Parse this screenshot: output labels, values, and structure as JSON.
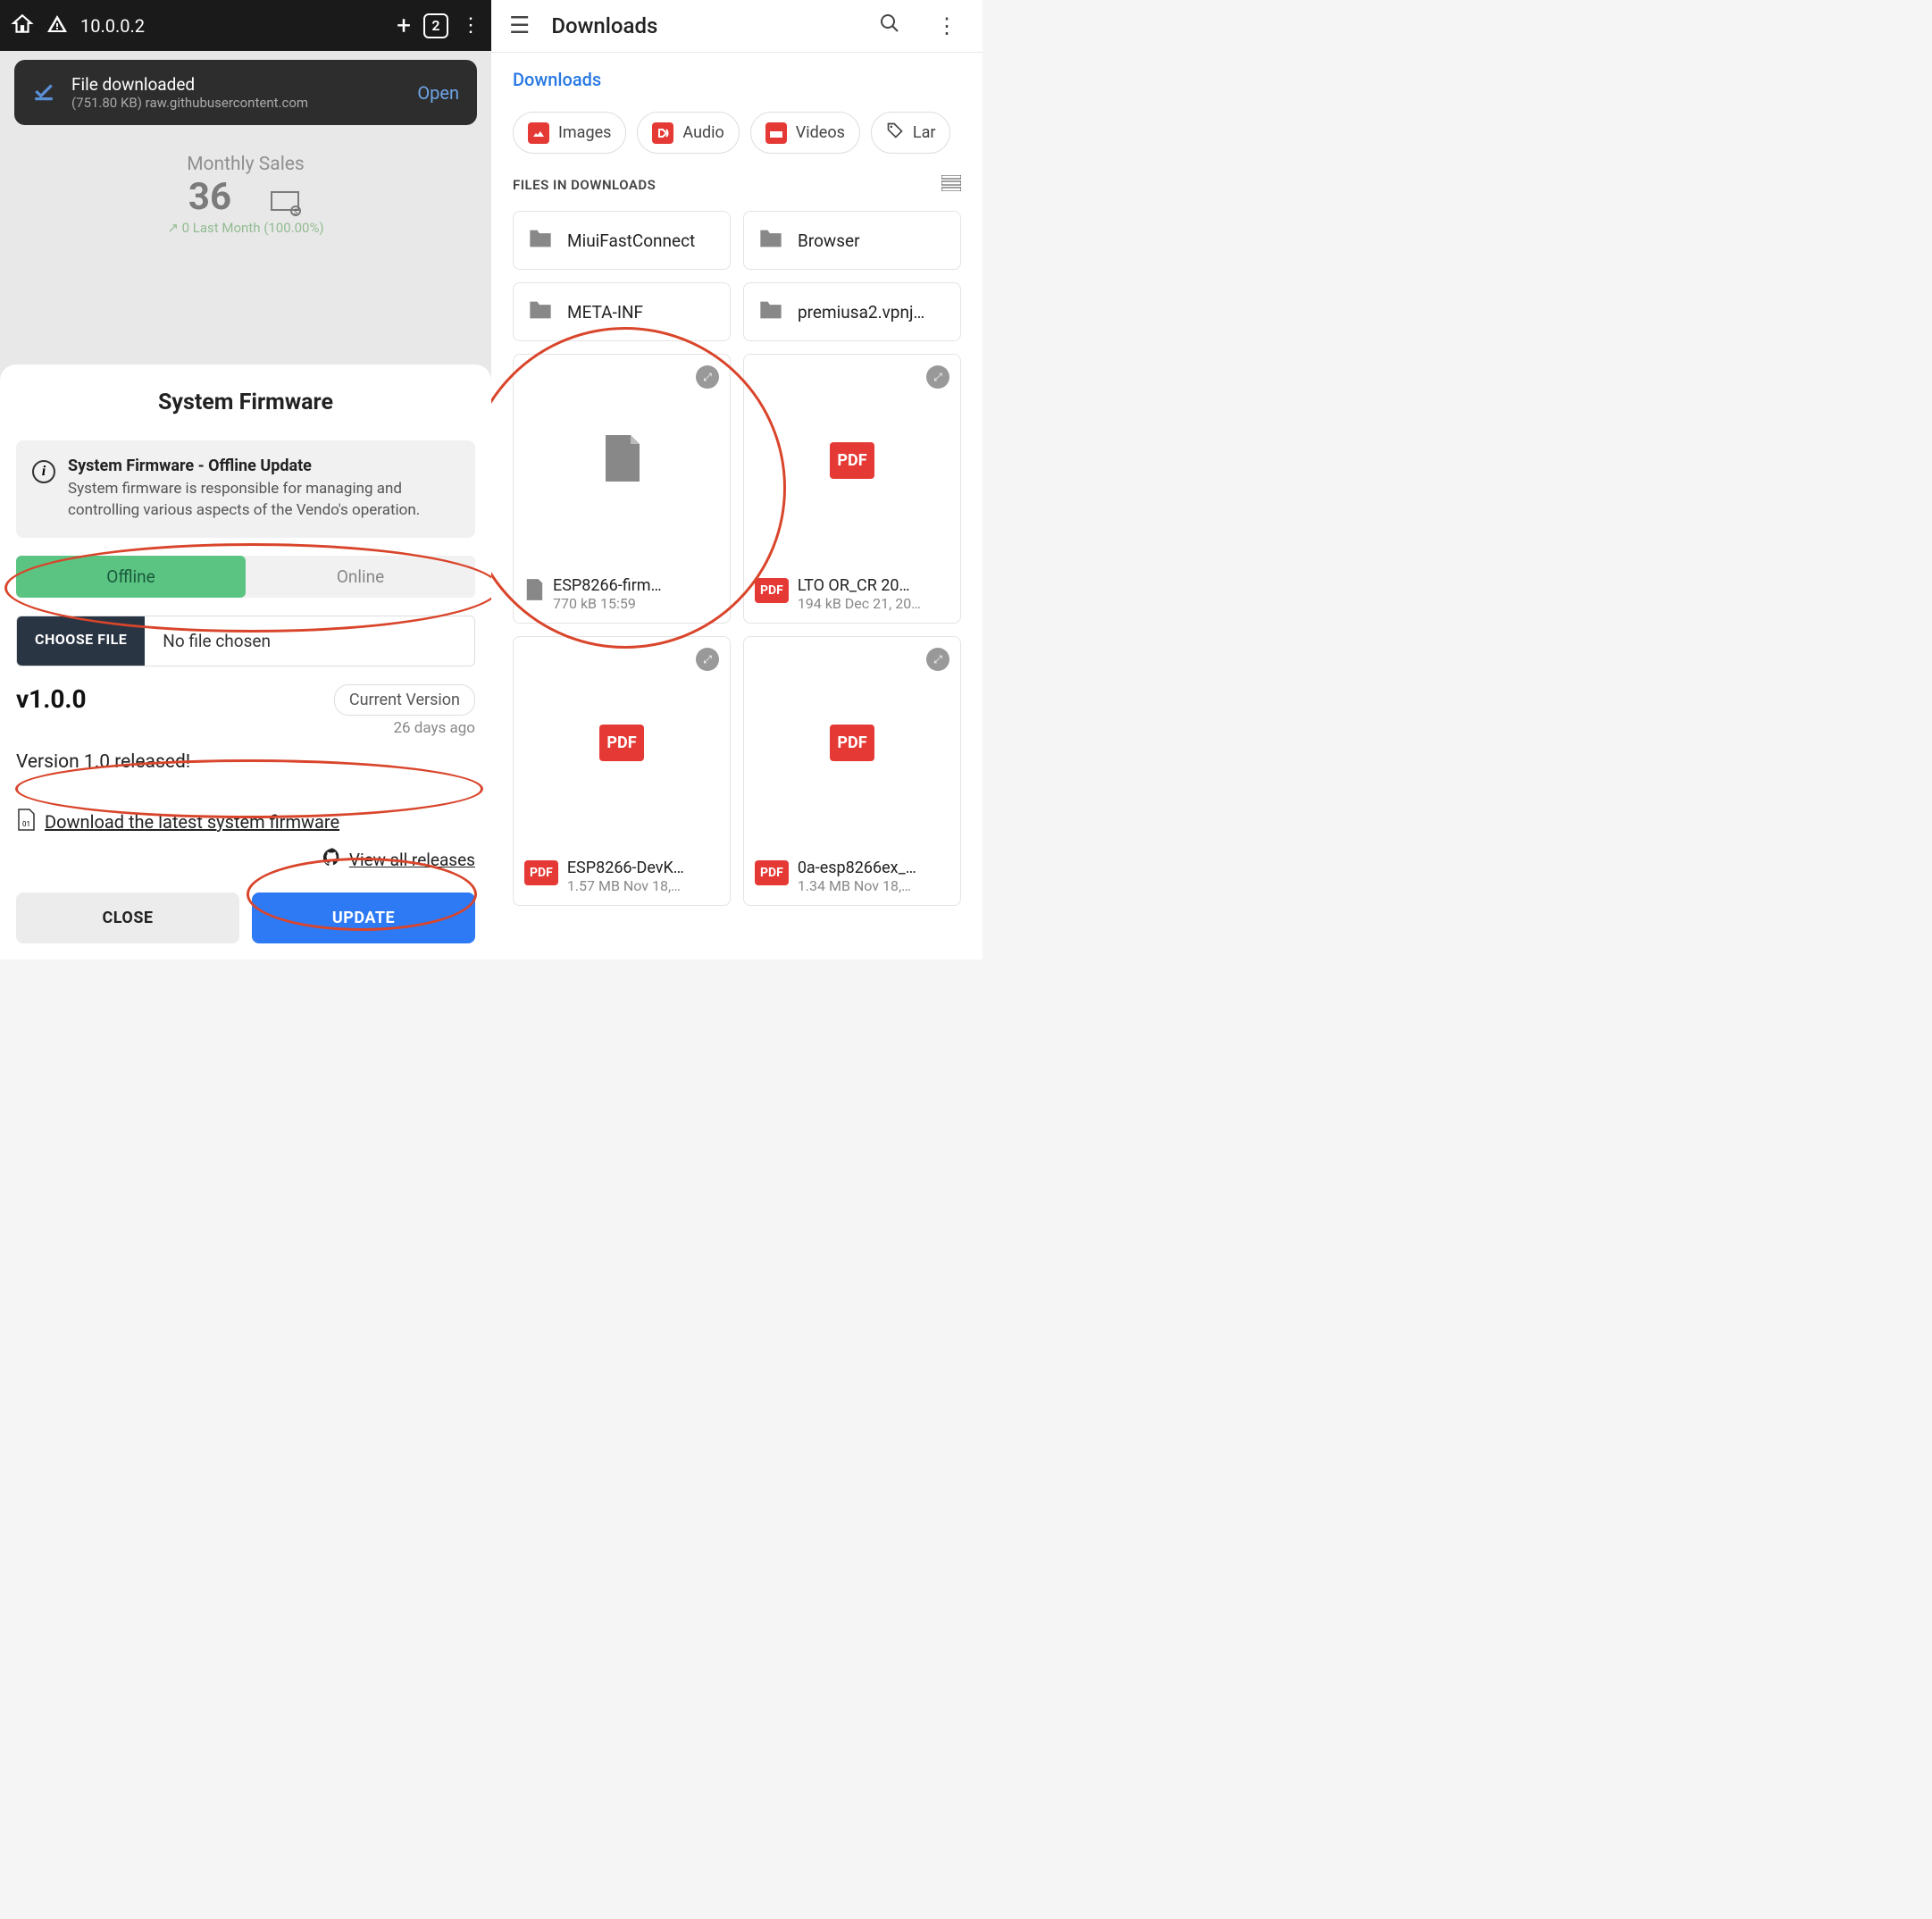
{
  "browser": {
    "url": "10.0.0.2",
    "tab_count": "2",
    "toast": {
      "title": "File downloaded",
      "subtitle": "(751.80 KB) raw.githubusercontent.com",
      "action": "Open"
    },
    "bg_card": {
      "title": "Monthly Sales",
      "value": "36",
      "meta": "↗ 0 Last Month (100.00%)"
    }
  },
  "modal": {
    "title": "System Firmware",
    "info_title": "System Firmware - Offline Update",
    "info_body": "System firmware is responsible for managing and controlling various aspects of the Vendo's operation.",
    "tab_offline": "Offline",
    "tab_online": "Online",
    "choose_file": "CHOOSE FILE",
    "no_file": "No file chosen",
    "version": "v1.0.0",
    "current": "Current Version",
    "days_ago": "26 days ago",
    "release_note": "Version 1.0 released!",
    "dl_link": "Download the latest system firmware",
    "gh_link": "View all releases",
    "close": "CLOSE",
    "update": "UPDATE"
  },
  "fm": {
    "title": "Downloads",
    "breadcrumb": "Downloads",
    "chips": {
      "images": "Images",
      "audio": "Audio",
      "videos": "Videos",
      "large": "Lar"
    },
    "section": "FILES IN DOWNLOADS",
    "folders": [
      {
        "name": "MiuiFastConnect"
      },
      {
        "name": "Browser"
      },
      {
        "name": "META-INF"
      },
      {
        "name": "premiusa2.vpnj…"
      }
    ],
    "files": [
      {
        "name": "ESP8266-firm…",
        "meta": "770 kB 15:59",
        "type": "file"
      },
      {
        "name": "LTO OR_CR 20…",
        "meta": "194 kB Dec 21, 20…",
        "type": "pdf"
      },
      {
        "name": "ESP8266-DevK…",
        "meta": "1.57 MB Nov 18,…",
        "type": "pdf"
      },
      {
        "name": "0a-esp8266ex_…",
        "meta": "1.34 MB Nov 18,…",
        "type": "pdf"
      }
    ]
  }
}
